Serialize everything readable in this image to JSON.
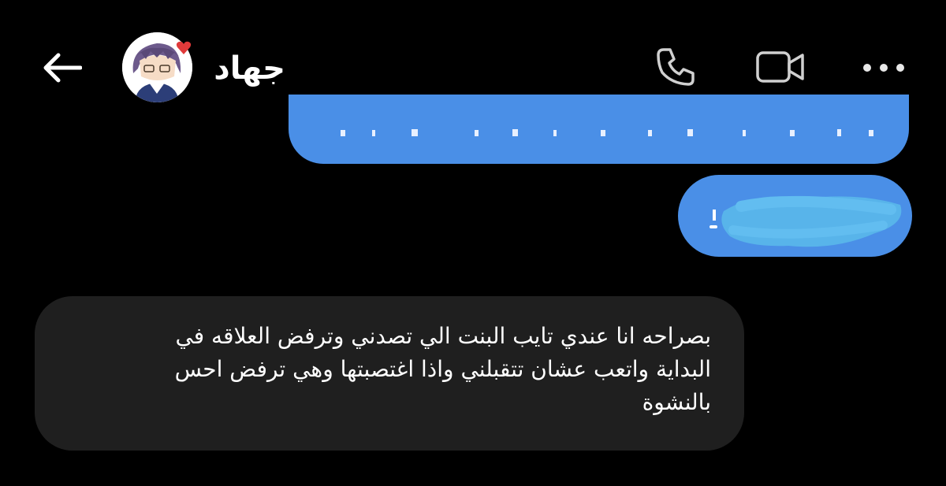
{
  "header": {
    "contact_name": "جهاد",
    "back_icon": "arrow-left-icon",
    "call_icon": "phone-icon",
    "video_icon": "video-camera-icon",
    "more_icon": "more-horizontal-icon"
  },
  "messages": [
    {
      "direction": "outgoing",
      "text": ""
    },
    {
      "direction": "outgoing",
      "text": ""
    },
    {
      "direction": "incoming",
      "lines": [
        "بصراحه انا عندي تايب البنت الي تصدني وترفض العلاقه في",
        "البداية واتعب عشان تتقبلني واذا اغتصبتها وهي ترفض احس",
        "بالنشوة"
      ]
    }
  ],
  "colors": {
    "background": "#000000",
    "outgoing_bubble": "#4a8fe7",
    "incoming_bubble": "#1f1f1f",
    "text": "#ffffff"
  }
}
